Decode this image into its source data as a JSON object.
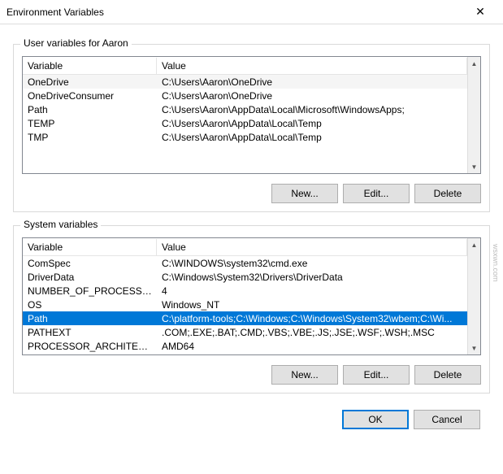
{
  "window": {
    "title": "Environment Variables",
    "close": "✕"
  },
  "userSection": {
    "label": "User variables for Aaron",
    "headers": {
      "variable": "Variable",
      "value": "Value"
    },
    "rows": [
      {
        "name": "OneDrive",
        "value": "C:\\Users\\Aaron\\OneDrive"
      },
      {
        "name": "OneDriveConsumer",
        "value": "C:\\Users\\Aaron\\OneDrive"
      },
      {
        "name": "Path",
        "value": "C:\\Users\\Aaron\\AppData\\Local\\Microsoft\\WindowsApps;"
      },
      {
        "name": "TEMP",
        "value": "C:\\Users\\Aaron\\AppData\\Local\\Temp"
      },
      {
        "name": "TMP",
        "value": "C:\\Users\\Aaron\\AppData\\Local\\Temp"
      }
    ],
    "buttons": {
      "new": "New...",
      "edit": "Edit...",
      "delete": "Delete"
    }
  },
  "systemSection": {
    "label": "System variables",
    "headers": {
      "variable": "Variable",
      "value": "Value"
    },
    "rows": [
      {
        "name": "ComSpec",
        "value": "C:\\WINDOWS\\system32\\cmd.exe"
      },
      {
        "name": "DriverData",
        "value": "C:\\Windows\\System32\\Drivers\\DriverData"
      },
      {
        "name": "NUMBER_OF_PROCESSORS",
        "value": "4"
      },
      {
        "name": "OS",
        "value": "Windows_NT"
      },
      {
        "name": "Path",
        "value": "C:\\platform-tools;C:\\Windows;C:\\Windows\\System32\\wbem;C:\\Wi...",
        "selected": true
      },
      {
        "name": "PATHEXT",
        "value": ".COM;.EXE;.BAT;.CMD;.VBS;.VBE;.JS;.JSE;.WSF;.WSH;.MSC"
      },
      {
        "name": "PROCESSOR_ARCHITECTURE",
        "value": "AMD64"
      }
    ],
    "buttons": {
      "new": "New...",
      "edit": "Edit...",
      "delete": "Delete"
    }
  },
  "footer": {
    "ok": "OK",
    "cancel": "Cancel"
  },
  "watermark": "wsxwn.com"
}
